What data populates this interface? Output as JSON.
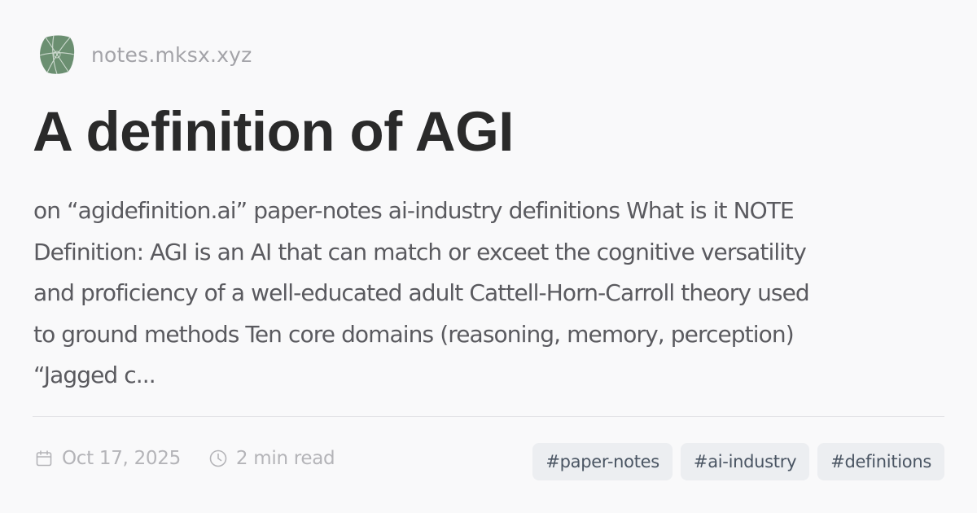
{
  "site": {
    "name": "notes.mksx.xyz",
    "logo_icon": "globe-leaf-logo",
    "logo_color": "#6b8f71"
  },
  "post": {
    "title": "A definition of AGI",
    "excerpt_lines": [
      "on “agidefinition.ai” paper-notes ai-industry definitions What is it NOTE",
      "Definition: AGI is an AI that can match or exceet the cognitive versatility",
      "and proficiency of a well-educated adult Cattell-Horn-Carroll theory used",
      "to ground methods Ten core domains (reasoning, memory, perception)",
      "“Jagged c..."
    ],
    "date": "Oct 17, 2025",
    "date_icon": "calendar-icon",
    "read_time": "2 min read",
    "read_time_icon": "clock-icon",
    "tags": [
      "#paper-notes",
      "#ai-industry",
      "#definitions"
    ]
  },
  "colors": {
    "background": "#f9f9fa",
    "title": "#2a2a2a",
    "excerpt": "#5a5a5f",
    "meta": "#b4b4b8",
    "tag_bg": "#eceef1",
    "tag_text": "#4a5563"
  }
}
